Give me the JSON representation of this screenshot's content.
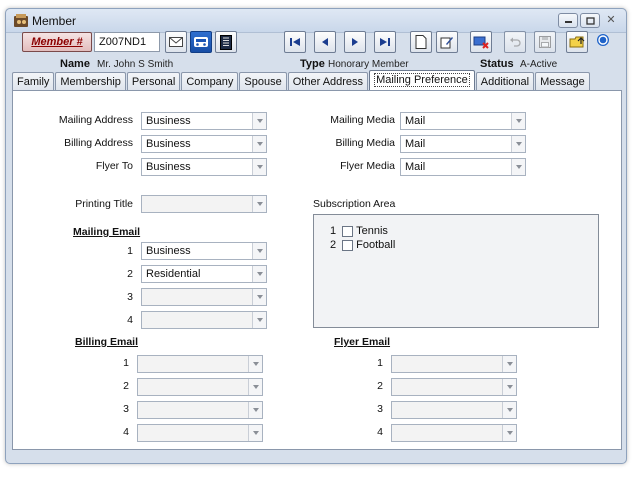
{
  "window": {
    "title": "Member",
    "buttons": [
      "minimize",
      "maximize",
      "close"
    ]
  },
  "toolbar": {
    "member_label": "Member #",
    "member_id": "Z007ND1",
    "buttons": [
      "mail-icon",
      "car-icon",
      "book-icon",
      "first-record-icon",
      "previous-record-icon",
      "next-record-icon",
      "last-record-icon",
      "new-record-icon",
      "edit-record-icon",
      "delete-record-icon",
      "undo-icon",
      "save-icon",
      "open-folder-icon",
      "info-icon"
    ]
  },
  "info": {
    "name_label": "Name",
    "name_value": "Mr. John S Smith",
    "type_label": "Type",
    "type_value": "Honorary Member",
    "status_label": "Status",
    "status_value": "A-Active"
  },
  "tabs": [
    "Family",
    "Membership",
    "Personal",
    "Company",
    "Spouse",
    "Other Address",
    "Mailing Preference",
    "Additional",
    "Message"
  ],
  "active_tab": "Mailing Preference",
  "form": {
    "mailing_address_label": "Mailing Address",
    "mailing_address": "Business",
    "billing_address_label": "Billing Address",
    "billing_address": "Business",
    "flyer_to_label": "Flyer To",
    "flyer_to": "Business",
    "mailing_media_label": "Mailing Media",
    "mailing_media": "Mail",
    "billing_media_label": "Billing Media",
    "billing_media": "Mail",
    "flyer_media_label": "Flyer Media",
    "flyer_media": "Mail",
    "printing_title_label": "Printing Title",
    "printing_title": "",
    "subscription_area_label": "Subscription Area",
    "subscriptions": [
      {
        "num": "1",
        "label": "Tennis",
        "checked": false
      },
      {
        "num": "2",
        "label": "Football",
        "checked": false
      }
    ],
    "mailing_email_label": "Mailing Email",
    "mailing_email": [
      {
        "num": "1",
        "value": "Business"
      },
      {
        "num": "2",
        "value": "Residential"
      },
      {
        "num": "3",
        "value": ""
      },
      {
        "num": "4",
        "value": ""
      }
    ],
    "billing_email_label": "Billing Email",
    "billing_email": [
      {
        "num": "1",
        "value": ""
      },
      {
        "num": "2",
        "value": ""
      },
      {
        "num": "3",
        "value": ""
      },
      {
        "num": "4",
        "value": ""
      }
    ],
    "flyer_email_label": "Flyer Email",
    "flyer_email": [
      {
        "num": "1",
        "value": ""
      },
      {
        "num": "2",
        "value": ""
      },
      {
        "num": "3",
        "value": ""
      },
      {
        "num": "4",
        "value": ""
      }
    ]
  }
}
